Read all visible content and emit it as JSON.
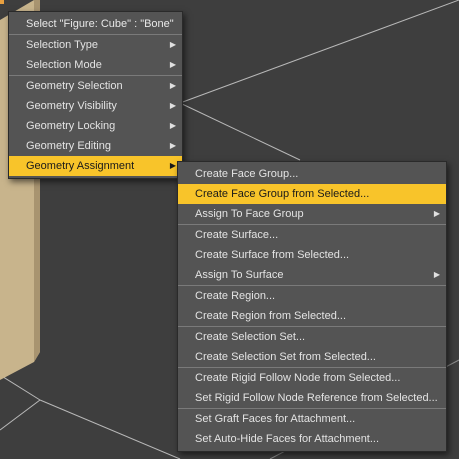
{
  "colors": {
    "viewport_bg": "#3e3e3e",
    "menu_bg": "#545454",
    "highlight": "#f8c42a",
    "text": "#e3e3e3",
    "bone": "#c8b48c"
  },
  "main_menu": {
    "title_item": "Select \"Figure: Cube\" : \"Bone\"",
    "items": [
      {
        "label": "Selection Type",
        "submenu": true
      },
      {
        "label": "Selection Mode",
        "submenu": true
      },
      {
        "label": "Geometry Selection",
        "submenu": true
      },
      {
        "label": "Geometry Visibility",
        "submenu": true
      },
      {
        "label": "Geometry Locking",
        "submenu": true
      },
      {
        "label": "Geometry Editing",
        "submenu": true
      },
      {
        "label": "Geometry Assignment",
        "submenu": true,
        "highlighted": true
      }
    ]
  },
  "sub_menu": {
    "items": [
      {
        "label": "Create Face Group..."
      },
      {
        "label": "Create Face Group from Selected...",
        "highlighted": true
      },
      {
        "label": "Assign To Face Group",
        "submenu": true
      },
      {
        "label": "Create Surface..."
      },
      {
        "label": "Create Surface from Selected..."
      },
      {
        "label": "Assign To Surface",
        "submenu": true
      },
      {
        "label": "Create Region..."
      },
      {
        "label": "Create Region from Selected..."
      },
      {
        "label": "Create Selection Set..."
      },
      {
        "label": "Create Selection Set from Selected..."
      },
      {
        "label": "Create Rigid Follow Node from Selected..."
      },
      {
        "label": "Set Rigid Follow Node Reference from Selected..."
      },
      {
        "label": "Set Graft Faces for Attachment..."
      },
      {
        "label": "Set Auto-Hide Faces for Attachment..."
      }
    ]
  },
  "icons": {
    "submenu_arrow": "▶"
  }
}
